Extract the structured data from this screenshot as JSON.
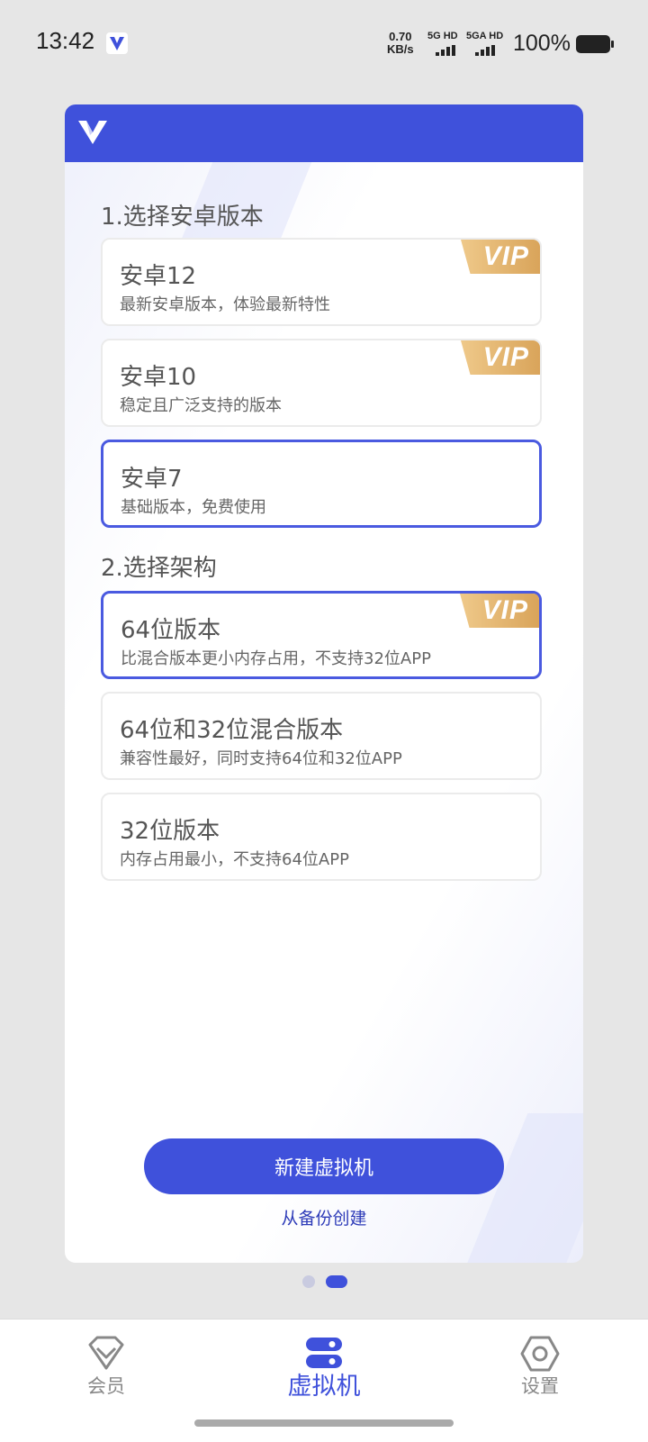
{
  "status_bar": {
    "time": "13:42",
    "net_speed_value": "0.70",
    "net_speed_unit": "KB/s",
    "sim1_label": "5G HD",
    "sim2_label": "5GA HD",
    "battery_percent": "100%"
  },
  "colors": {
    "accent": "#3f51db",
    "vip_gold": "#dca85c"
  },
  "section1": {
    "title": "1.选择安卓版本",
    "options": [
      {
        "title": "安卓12",
        "desc": "最新安卓版本，体验最新特性",
        "vip": "VIP",
        "selected": false
      },
      {
        "title": "安卓10",
        "desc": "稳定且广泛支持的版本",
        "vip": "VIP",
        "selected": false
      },
      {
        "title": "安卓7",
        "desc": "基础版本，免费使用",
        "vip": "",
        "selected": true
      }
    ]
  },
  "section2": {
    "title": "2.选择架构",
    "options": [
      {
        "title": "64位版本",
        "desc": "比混合版本更小内存占用，不支持32位APP",
        "vip": "VIP",
        "selected": true
      },
      {
        "title": "64位和32位混合版本",
        "desc": "兼容性最好，同时支持64位和32位APP",
        "vip": "",
        "selected": false
      },
      {
        "title": "32位版本",
        "desc": "内存占用最小，不支持64位APP",
        "vip": "",
        "selected": false
      }
    ]
  },
  "actions": {
    "create_label": "新建虚拟机",
    "from_backup_label": "从备份创建"
  },
  "pager": {
    "count": 2,
    "active_index": 1
  },
  "bottom_nav": [
    {
      "label": "会员",
      "icon": "diamond-icon",
      "active": false
    },
    {
      "label": "虚拟机",
      "icon": "server-icon",
      "active": true
    },
    {
      "label": "设置",
      "icon": "hexagon-gear-icon",
      "active": false
    }
  ]
}
